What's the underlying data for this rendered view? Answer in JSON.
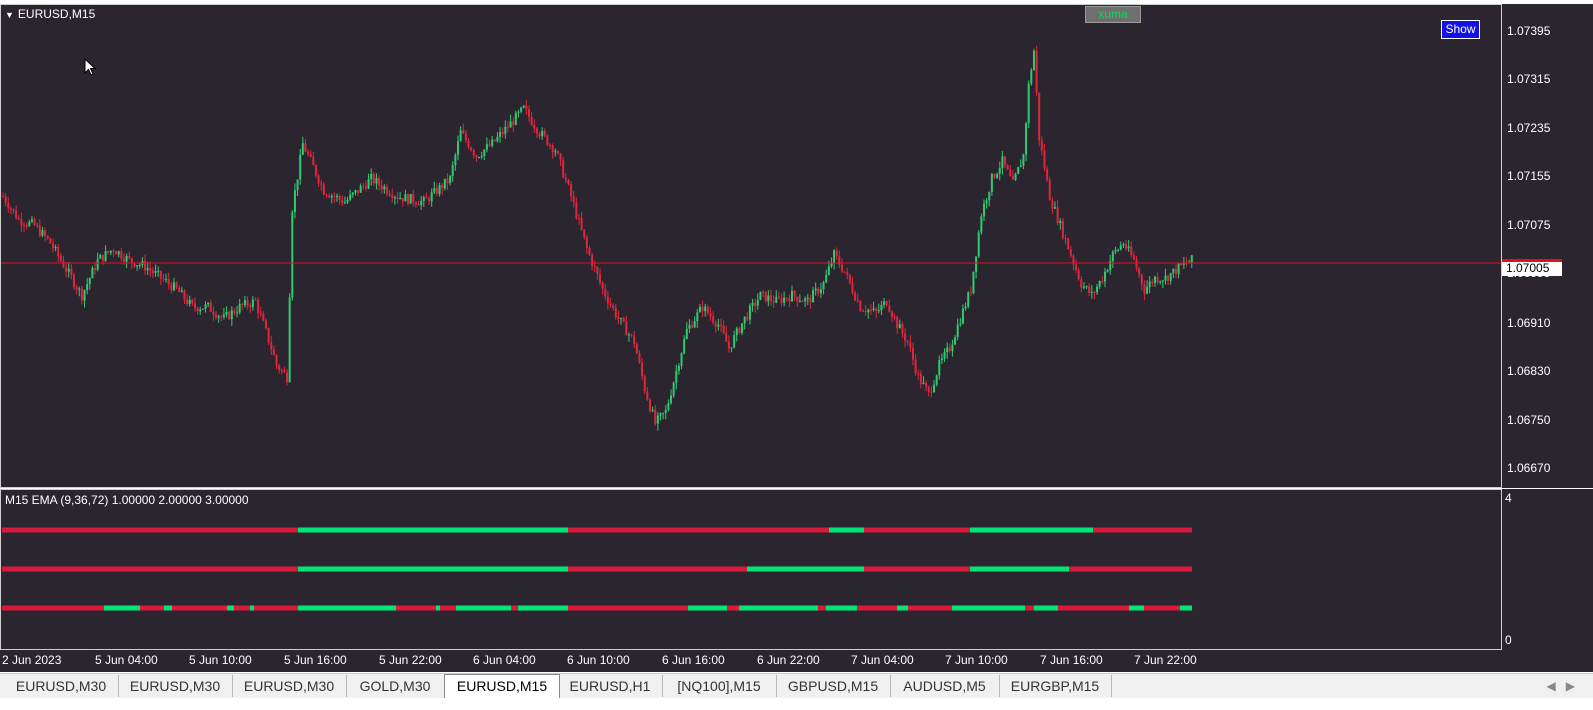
{
  "chart": {
    "symbol_title": "EURUSD,M15",
    "current_price": "1.07005",
    "price_ticks": [
      "1.07395",
      "1.07315",
      "1.07235",
      "1.07155",
      "1.07075",
      "1.06995",
      "1.06910",
      "1.06830",
      "1.06750",
      "1.06670"
    ],
    "time_ticks": [
      "2 Jun 2023",
      "5 Jun 04:00",
      "5 Jun 10:00",
      "5 Jun 16:00",
      "5 Jun 22:00",
      "6 Jun 04:00",
      "6 Jun 10:00",
      "6 Jun 16:00",
      "6 Jun 22:00",
      "7 Jun 04:00",
      "7 Jun 10:00",
      "7 Jun 16:00",
      "7 Jun 22:00"
    ],
    "xuma_label": "xuma",
    "show_label": "Show",
    "colors": {
      "bull": "#2ecc71",
      "bear": "#e0263c",
      "background": "#2b2530",
      "price_line": "#e01020"
    }
  },
  "indicator": {
    "title": "M15 EMA (9,36,72) 1.00000 2.00000 3.00000",
    "axis_top": "4",
    "axis_bottom": "0",
    "colors": {
      "up": "#00e676",
      "down": "#d81b3c"
    }
  },
  "tabs": [
    {
      "label": "EURUSD,M30",
      "active": false
    },
    {
      "label": "EURUSD,M30",
      "active": false
    },
    {
      "label": "EURUSD,M30",
      "active": false
    },
    {
      "label": "GOLD,M30",
      "active": false
    },
    {
      "label": "EURUSD,M15",
      "active": true
    },
    {
      "label": "EURUSD,H1",
      "active": false
    },
    {
      "label": "[NQ100],M15",
      "active": false
    },
    {
      "label": "GBPUSD,M15",
      "active": false
    },
    {
      "label": "AUDUSD,M5",
      "active": false
    },
    {
      "label": "EURGBP,M15",
      "active": false
    }
  ],
  "chart_data": {
    "type": "candlestick",
    "ylim": [
      1.0664,
      1.0743
    ],
    "current_price": 1.07005,
    "close_path": [
      [
        0,
        1.0711
      ],
      [
        6,
        1.0707
      ],
      [
        12,
        1.0706
      ],
      [
        18,
        1.0703
      ],
      [
        22,
        1.07
      ],
      [
        26,
        1.0697
      ],
      [
        30,
        1.0694
      ],
      [
        36,
        1.07
      ],
      [
        42,
        1.0702
      ],
      [
        48,
        1.07
      ],
      [
        54,
        1.0699
      ],
      [
        60,
        1.0697
      ],
      [
        66,
        1.0695
      ],
      [
        72,
        1.0692
      ],
      [
        78,
        1.0692
      ],
      [
        84,
        1.069
      ],
      [
        90,
        1.0692
      ],
      [
        96,
        1.0693
      ],
      [
        102,
        1.0685
      ],
      [
        104,
        1.0682
      ],
      [
        108,
        1.068
      ],
      [
        110,
        1.0709
      ],
      [
        114,
        1.072
      ],
      [
        122,
        1.0712
      ],
      [
        130,
        1.071
      ],
      [
        140,
        1.0714
      ],
      [
        150,
        1.0711
      ],
      [
        160,
        1.071
      ],
      [
        170,
        1.0714
      ],
      [
        174,
        1.0722
      ],
      [
        180,
        1.0718
      ],
      [
        186,
        1.072
      ],
      [
        192,
        1.0723
      ],
      [
        198,
        1.0726
      ],
      [
        204,
        1.0722
      ],
      [
        210,
        1.0719
      ],
      [
        216,
        1.0711
      ],
      [
        222,
        1.0702
      ],
      [
        228,
        1.0695
      ],
      [
        234,
        1.069
      ],
      [
        240,
        1.0686
      ],
      [
        244,
        1.0678
      ],
      [
        248,
        1.0672
      ],
      [
        252,
        1.0674
      ],
      [
        256,
        1.0681
      ],
      [
        260,
        1.0688
      ],
      [
        266,
        1.0692
      ],
      [
        272,
        1.0689
      ],
      [
        276,
        1.0685
      ],
      [
        282,
        1.069
      ],
      [
        288,
        1.0694
      ],
      [
        294,
        1.0693
      ],
      [
        300,
        1.0694
      ],
      [
        306,
        1.0693
      ],
      [
        312,
        1.0696
      ],
      [
        316,
        1.0701
      ],
      [
        320,
        1.0698
      ],
      [
        326,
        1.0692
      ],
      [
        332,
        1.0691
      ],
      [
        336,
        1.0693
      ],
      [
        340,
        1.0689
      ],
      [
        344,
        1.0686
      ],
      [
        348,
        1.068
      ],
      [
        352,
        1.0677
      ],
      [
        356,
        1.0682
      ],
      [
        360,
        1.0685
      ],
      [
        364,
        1.069
      ],
      [
        368,
        1.0695
      ],
      [
        372,
        1.0708
      ],
      [
        376,
        1.0714
      ],
      [
        380,
        1.0717
      ],
      [
        384,
        1.0713
      ],
      [
        388,
        1.0718
      ],
      [
        390,
        1.073
      ],
      [
        392,
        1.0736
      ],
      [
        394,
        1.0721
      ],
      [
        398,
        1.0711
      ],
      [
        402,
        1.0706
      ],
      [
        406,
        1.0701
      ],
      [
        410,
        1.0696
      ],
      [
        414,
        1.0694
      ],
      [
        418,
        1.0697
      ],
      [
        422,
        1.0701
      ],
      [
        426,
        1.0703
      ],
      [
        430,
        1.07
      ],
      [
        434,
        1.0695
      ],
      [
        438,
        1.0697
      ],
      [
        442,
        1.0697
      ],
      [
        448,
        1.0699
      ],
      [
        452,
        1.07
      ]
    ]
  }
}
